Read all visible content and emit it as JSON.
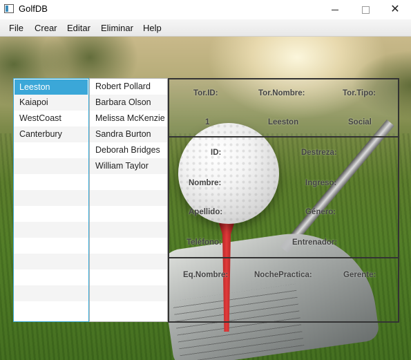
{
  "window": {
    "title": "GolfDB"
  },
  "menu": [
    "File",
    "Crear",
    "Editar",
    "Eliminar",
    "Help"
  ],
  "tournaments": {
    "items": [
      "Leeston",
      "Kaiapoi",
      "WestCoast",
      "Canterbury"
    ],
    "selected": "Leeston"
  },
  "players": {
    "items": [
      "Robert Pollard",
      "Barbara Olson",
      "Melissa McKenzie",
      "Sandra Burton",
      "Deborah Bridges",
      "William Taylor"
    ]
  },
  "tournament_info": {
    "id_label": "Tor.ID:",
    "name_label": "Tor.Nombre:",
    "type_label": "Tor.Tipo:",
    "id_value": "1",
    "name_value": "Leeston",
    "type_value": "Social"
  },
  "player_info": {
    "id_label": "ID:",
    "skill_label": "Destreza:",
    "name_label": "Nombre:",
    "income_label": "Ingreso:",
    "surname_label": "Apellido:",
    "gender_label": "Género:",
    "phone_label": "Teléfono:",
    "coach_label": "Entrenador:"
  },
  "team_info": {
    "name_label": "Eq.Nombre:",
    "practice_label": "NochePractica:",
    "manager_label": "Gerente:"
  }
}
